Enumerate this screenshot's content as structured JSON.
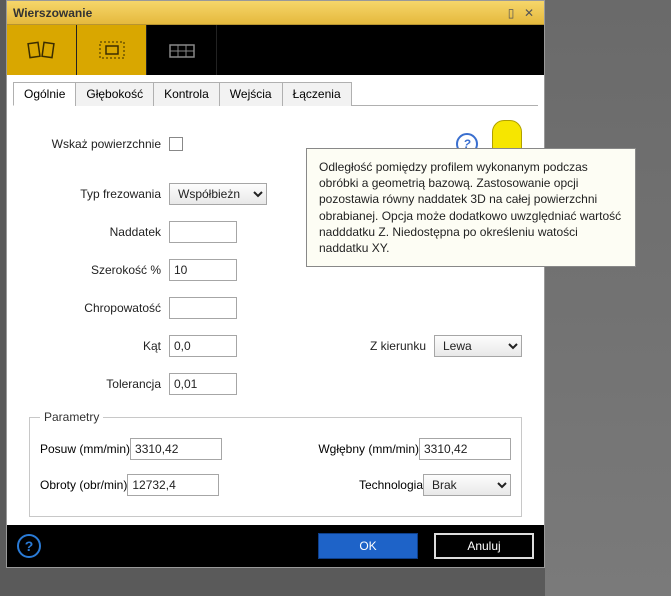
{
  "window": {
    "title": "Wierszowanie"
  },
  "tabs": {
    "t0": "Ogólnie",
    "t1": "Głębokość",
    "t2": "Kontrola",
    "t3": "Wejścia",
    "t4": "Łączenia"
  },
  "labels": {
    "surface": "Wskaż powierzchnie",
    "millType": "Typ frezowania",
    "allowance": "Naddatek",
    "widthPct": "Szerokość %",
    "roughness": "Chropowatość",
    "angle": "Kąt",
    "tolerance": "Tolerancja",
    "zdir": "Z kierunku",
    "paramsLegend": "Parametry",
    "feed": "Posuw (mm/min)",
    "rpm": "Obroty (obr/min)",
    "plunge": "Wgłębny (mm/min)",
    "tech": "Technologia"
  },
  "values": {
    "millType": "Współbieżn",
    "allowance": "",
    "widthPct": "10",
    "roughness": "",
    "angle": "0,0",
    "tolerance": "0,01",
    "zdir": "Lewa",
    "feed": "3310,42",
    "rpm": "12732,4",
    "plunge": "3310,42",
    "tech": "Brak"
  },
  "tooltip": "Odległość pomiędzy profilem wykonanym podczas obróbki a geometrią bazową. Zastosowanie opcji pozostawia równy naddatek 3D na całej powierzchni obrabianej. Opcja może dodatkowo uwzględniać wartość nadddatku Z.   Niedostępna po określeniu watości naddatku XY.",
  "footer": {
    "ok": "OK",
    "cancel": "Anuluj"
  }
}
